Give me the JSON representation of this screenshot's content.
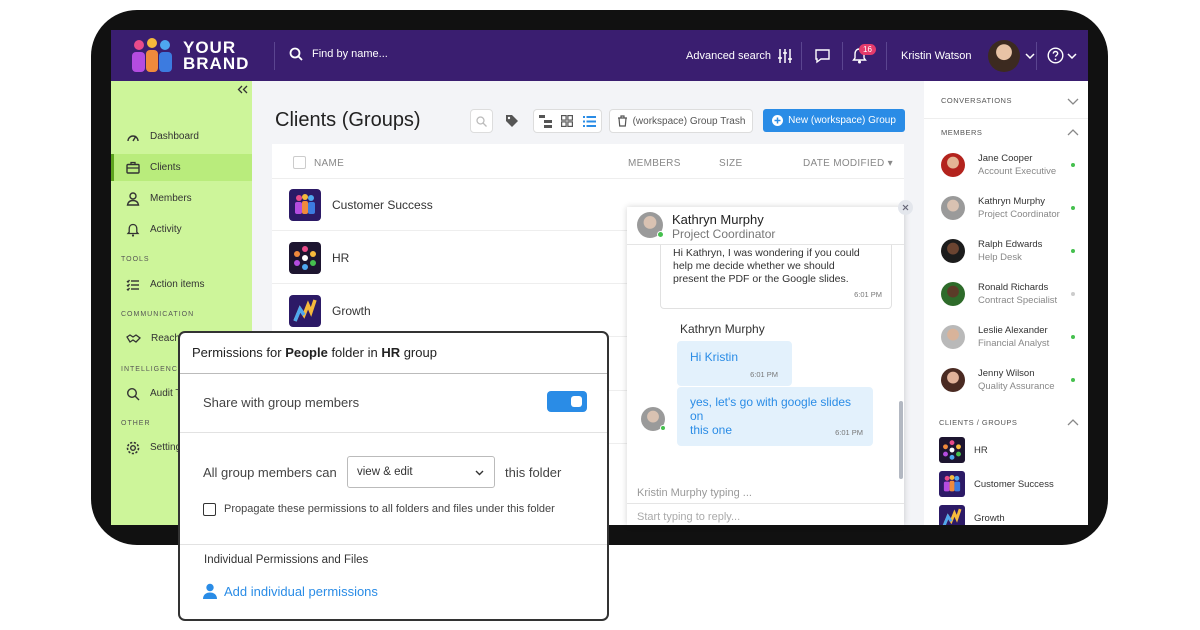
{
  "brand": {
    "line1": "YOUR",
    "line2": "BRAND"
  },
  "topbar": {
    "search_placeholder": "Find by name...",
    "advanced_search": "Advanced search",
    "notification_count": "16",
    "user_name": "Kristin Watson"
  },
  "sidebar": {
    "items": [
      {
        "label": "Dashboard"
      },
      {
        "label": "Clients"
      },
      {
        "label": "Members"
      },
      {
        "label": "Activity"
      },
      {
        "label": "Action items"
      },
      {
        "label": "Reachouts"
      },
      {
        "label": "Audit T"
      },
      {
        "label": "Setting"
      }
    ],
    "sections": {
      "tools": "TOOLS",
      "communication": "COMMUNICATION",
      "intelligence": "INTELLIGENCE",
      "other": "OTHER"
    }
  },
  "main": {
    "title": "Clients (Groups)",
    "trash_button": "(workspace) Group Trash",
    "new_button": "New (workspace) Group",
    "columns": {
      "name": "NAME",
      "members": "MEMBERS",
      "size": "SIZE",
      "date": "DATE MODIFIED"
    },
    "rows": [
      {
        "name": "Customer Success"
      },
      {
        "name": "HR"
      },
      {
        "name": "Growth"
      }
    ]
  },
  "chat": {
    "header_name": "Kathryn Murphy",
    "header_role": "Project Coordinator",
    "msg1": {
      "line1": "Hi Kathryn, I was wondering if you could",
      "line2": "help me decide whether we should",
      "line3": "present the PDF or the Google slides.",
      "time": "6:01 PM"
    },
    "sender": "Kathryn Murphy",
    "msg2": {
      "text": "Hi Kristin",
      "time": "6:01 PM"
    },
    "msg3": {
      "line1": "yes, let's go with google slides on",
      "line2": "this one",
      "time": "6:01 PM"
    },
    "typing": "Kristin Murphy typing ...",
    "input_placeholder": "Start typing to reply..."
  },
  "rpanel": {
    "conversations": "CONVERSATIONS",
    "members_head": "MEMBERS",
    "members": [
      {
        "name": "Jane Cooper",
        "role": "Account Executive",
        "online": true
      },
      {
        "name": "Kathryn Murphy",
        "role": "Project Coordinator",
        "online": true
      },
      {
        "name": "Ralph Edwards",
        "role": "Help Desk",
        "online": true
      },
      {
        "name": "Ronald Richards",
        "role": "Contract Specialist",
        "online": false
      },
      {
        "name": "Leslie Alexander",
        "role": "Financial Analyst",
        "online": true
      },
      {
        "name": "Jenny Wilson",
        "role": "Quality Assurance",
        "online": true
      }
    ],
    "groups_head": "CLIENTS / GROUPS",
    "groups": [
      {
        "name": "HR"
      },
      {
        "name": "Customer Success"
      },
      {
        "name": "Growth"
      }
    ]
  },
  "permissions": {
    "title_pre": "Permissions  for ",
    "title_folder": "People",
    "title_mid": " folder in ",
    "title_group": "HR",
    "title_post": " group",
    "share_label": "Share with group members",
    "share_enabled": true,
    "all_members_label": "All group members can",
    "select_value": "view & edit",
    "this_folder": "this folder",
    "propagate_label": "Propagate these permissions to all folders and files under this folder",
    "individual_head": "Individual Permissions and Files",
    "add_individual": "Add individual permissions"
  },
  "colors": {
    "topbar": "#3a1e70",
    "sidebar": "#cdf59a",
    "accent": "#2a8ce6",
    "online": "#45c04e",
    "badge": "#e53a6b"
  }
}
